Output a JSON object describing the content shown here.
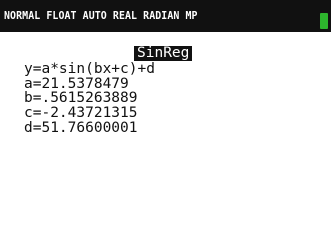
{
  "status_bar": {
    "mode_text": "NORMAL FLOAT AUTO REAL RADIAN MP",
    "battery_icon": "battery-icon",
    "battery_color": "#2db52d"
  },
  "result": {
    "title": "SinReg",
    "equation": "y=a*sin(bx+c)+d",
    "params": [
      "a=21.5378479",
      "b=.5615263889",
      "c=-2.43721315",
      "d=51.76600001"
    ]
  }
}
